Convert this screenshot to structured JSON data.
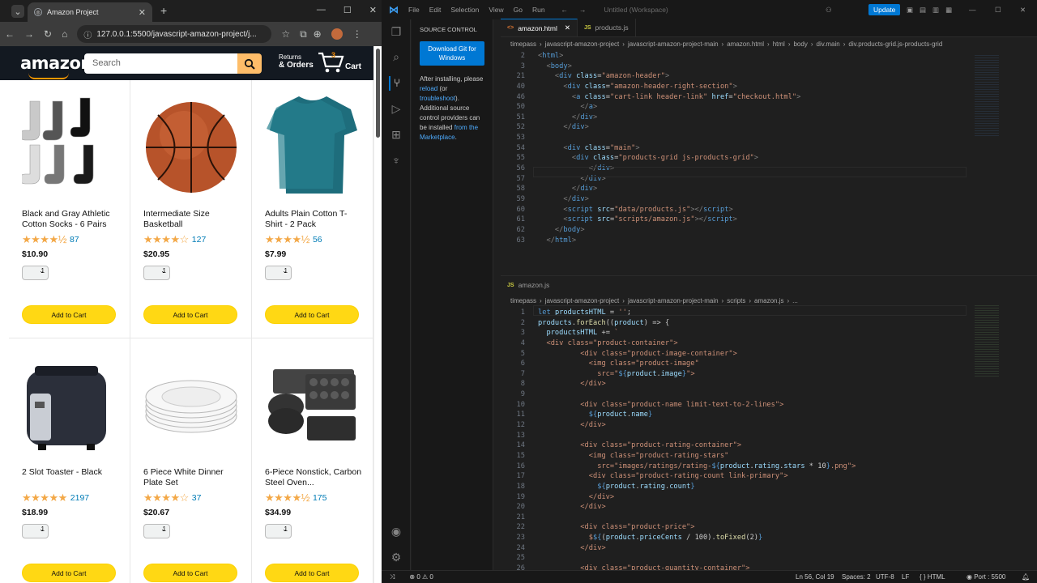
{
  "browser": {
    "tab_title": "Amazon Project",
    "url": "127.0.0.1:5500/javascript-amazon-project/j..."
  },
  "amazon": {
    "logo": "amazon",
    "search_placeholder": "Search",
    "returns_line1": "Returns",
    "returns_line2": "& Orders",
    "cart_count": "3",
    "cart_label": "Cart",
    "products": [
      {
        "name": "Black and Gray Athletic Cotton Socks - 6 Pairs",
        "stars": "★★★★½",
        "count": "87",
        "price": "$10.90",
        "qty": "1",
        "add": "Add to Cart",
        "icon": "socks"
      },
      {
        "name": "Intermediate Size Basketball",
        "stars": "★★★★☆",
        "count": "127",
        "price": "$20.95",
        "qty": "1",
        "add": "Add to Cart",
        "icon": "basketball"
      },
      {
        "name": "Adults Plain Cotton T-Shirt - 2 Pack",
        "stars": "★★★★½",
        "count": "56",
        "price": "$7.99",
        "qty": "1",
        "add": "Add to Cart",
        "icon": "tshirt"
      },
      {
        "name": "2 Slot Toaster - Black",
        "stars": "★★★★★",
        "count": "2197",
        "price": "$18.99",
        "qty": "1",
        "add": "Add to Cart",
        "icon": "toaster"
      },
      {
        "name": "6 Piece White Dinner Plate Set",
        "stars": "★★★★☆",
        "count": "37",
        "price": "$20.67",
        "qty": "1",
        "add": "Add to Cart",
        "icon": "plates"
      },
      {
        "name": "6-Piece Nonstick, Carbon Steel Oven...",
        "stars": "★★★★½",
        "count": "175",
        "price": "$34.99",
        "qty": "1",
        "add": "Add to Cart",
        "icon": "bakeware"
      }
    ]
  },
  "vscode": {
    "menu": [
      "File",
      "Edit",
      "Selection",
      "View",
      "Go",
      "Run"
    ],
    "workspace": "Untitled (Workspace)",
    "update_label": "Update",
    "sidebar_title": "SOURCE CONTROL",
    "download_git": "Download Git for Windows",
    "sidebar_text1": "After installing, please",
    "sidebar_link_reload": "reload",
    "sidebar_text2": "(or",
    "sidebar_link_troubleshoot": "troubleshoot",
    "sidebar_text3": "). Additional source control providers can be installed",
    "sidebar_link_marketplace": "from the Marketplace",
    "editor1": {
      "tabs": [
        {
          "label": "amazon.html",
          "active": true
        },
        {
          "label": "products.js",
          "active": false
        }
      ],
      "breadcrumb": [
        "timepass",
        "javascript-amazon-project",
        "javascript-amazon-project-main",
        "amazon.html",
        "html",
        "body",
        "div.main",
        "div.products-grid.js-products-grid"
      ],
      "lines": [
        {
          "n": "2",
          "html": "<span class='punc'>&lt;</span><span class='tag'>html</span><span class='punc'>&gt;</span>"
        },
        {
          "n": "3",
          "html": "  <span class='punc'>&lt;</span><span class='tag'>body</span><span class='punc'>&gt;</span>"
        },
        {
          "n": "21",
          "html": "    <span class='punc'>&lt;</span><span class='tag'>div</span> <span class='attr'>class</span>=<span class='str'>\"amazon-header\"</span><span class='punc'>&gt;</span>"
        },
        {
          "n": "40",
          "html": "      <span class='punc'>&lt;</span><span class='tag'>div</span> <span class='attr'>class</span>=<span class='str'>\"amazon-header-right-section\"</span><span class='punc'>&gt;</span>"
        },
        {
          "n": "46",
          "html": "        <span class='punc'>&lt;</span><span class='tag'>a</span> <span class='attr'>class</span>=<span class='str'>\"cart-link header-link\"</span> <span class='attr'>href</span>=<span class='str'>\"checkout.html\"</span><span class='punc'>&gt;</span>"
        },
        {
          "n": "50",
          "html": "          <span class='punc'>&lt;/</span><span class='tag'>a</span><span class='punc'>&gt;</span>"
        },
        {
          "n": "51",
          "html": "        <span class='punc'>&lt;/</span><span class='tag'>div</span><span class='punc'>&gt;</span>"
        },
        {
          "n": "52",
          "html": "      <span class='punc'>&lt;/</span><span class='tag'>div</span><span class='punc'>&gt;</span>"
        },
        {
          "n": "53",
          "html": ""
        },
        {
          "n": "54",
          "html": "      <span class='punc'>&lt;</span><span class='tag'>div</span> <span class='attr'>class</span>=<span class='str'>\"main\"</span><span class='punc'>&gt;</span>"
        },
        {
          "n": "55",
          "html": "        <span class='punc'>&lt;</span><span class='tag'>div</span> <span class='attr'>class</span>=<span class='str'>\"products-grid js-products-grid\"</span><span class='punc'>&gt;</span>"
        },
        {
          "n": "56",
          "html": "            <span class='punc'>&lt;/</span><span class='tag'>div</span><span class='punc'>&gt;</span>"
        },
        {
          "n": "57",
          "html": "          <span class='punc'>&lt;/</span><span class='tag'>div</span><span class='punc'>&gt;</span>"
        },
        {
          "n": "58",
          "html": "        <span class='punc'>&lt;/</span><span class='tag'>div</span><span class='punc'>&gt;</span>"
        },
        {
          "n": "59",
          "html": "      <span class='punc'>&lt;/</span><span class='tag'>div</span><span class='punc'>&gt;</span>"
        },
        {
          "n": "60",
          "html": "      <span class='punc'>&lt;</span><span class='tag'>script</span> <span class='attr'>src</span>=<span class='str'>\"data/products.js\"</span><span class='punc'>&gt;&lt;/</span><span class='tag'>script</span><span class='punc'>&gt;</span>"
        },
        {
          "n": "61",
          "html": "      <span class='punc'>&lt;</span><span class='tag'>script</span> <span class='attr'>src</span>=<span class='str'>\"scripts/amazon.js\"</span><span class='punc'>&gt;&lt;/</span><span class='tag'>script</span><span class='punc'>&gt;</span>"
        },
        {
          "n": "62",
          "html": "    <span class='punc'>&lt;/</span><span class='tag'>body</span><span class='punc'>&gt;</span>"
        },
        {
          "n": "63",
          "html": "  <span class='punc'>&lt;/</span><span class='tag'>html</span><span class='punc'>&gt;</span>"
        }
      ]
    },
    "editor2": {
      "tab": "amazon.js",
      "breadcrumb": [
        "timepass",
        "javascript-amazon-project",
        "javascript-amazon-project-main",
        "scripts",
        "amazon.js",
        "..."
      ],
      "lines": [
        {
          "n": "1",
          "html": "<span class='kw'>let</span> <span class='var'>productsHTML</span> = <span class='str'>''</span>;"
        },
        {
          "n": "2",
          "html": "<span class='var'>products</span>.<span class='fn'>forEach</span>((<span class='var'>product</span>) =&gt; {"
        },
        {
          "n": "3",
          "html": "  <span class='var'>productsHTML</span> += <span class='str'>`</span>"
        },
        {
          "n": "4",
          "html": "<span class='str'>  &lt;div class=\"product-container\"&gt;</span>"
        },
        {
          "n": "5",
          "html": "<span class='str'>          &lt;div class=\"product-image-container\"&gt;</span>"
        },
        {
          "n": "6",
          "html": "<span class='str'>            &lt;img class=\"product-image\"</span>"
        },
        {
          "n": "7",
          "html": "<span class='str'>              src=\"</span><span class='kw'>${</span><span class='var'>product</span>.<span class='var'>image</span><span class='kw'>}</span><span class='str'>\"&gt;</span>"
        },
        {
          "n": "8",
          "html": "<span class='str'>          &lt;/div&gt;</span>"
        },
        {
          "n": "9",
          "html": ""
        },
        {
          "n": "10",
          "html": "<span class='str'>          &lt;div class=\"product-name limit-text-to-2-lines\"&gt;</span>"
        },
        {
          "n": "11",
          "html": "            <span class='kw'>${</span><span class='var'>product</span>.<span class='var'>name</span><span class='kw'>}</span>"
        },
        {
          "n": "12",
          "html": "<span class='str'>          &lt;/div&gt;</span>"
        },
        {
          "n": "13",
          "html": ""
        },
        {
          "n": "14",
          "html": "<span class='str'>          &lt;div class=\"product-rating-container\"&gt;</span>"
        },
        {
          "n": "15",
          "html": "<span class='str'>            &lt;img class=\"product-rating-stars\"</span>"
        },
        {
          "n": "16",
          "html": "<span class='str'>              src=\"images/ratings/rating-</span><span class='kw'>${</span><span class='var'>product</span>.<span class='var'>rating</span>.<span class='var'>stars</span> * 10<span class='kw'>}</span><span class='str'>.png\"&gt;</span>"
        },
        {
          "n": "17",
          "html": "<span class='str'>            &lt;div class=\"product-rating-count link-primary\"&gt;</span>"
        },
        {
          "n": "18",
          "html": "              <span class='kw'>${</span><span class='var'>product</span>.<span class='var'>rating</span>.<span class='var'>count</span><span class='kw'>}</span>"
        },
        {
          "n": "19",
          "html": "<span class='str'>            &lt;/div&gt;</span>"
        },
        {
          "n": "20",
          "html": "<span class='str'>          &lt;/div&gt;</span>"
        },
        {
          "n": "21",
          "html": ""
        },
        {
          "n": "22",
          "html": "<span class='str'>          &lt;div class=\"product-price\"&gt;</span>"
        },
        {
          "n": "23",
          "html": "            <span class='str'>$</span><span class='kw'>${</span>(<span class='var'>product</span>.<span class='var'>priceCents</span> / 100).<span class='fn'>toFixed</span>(2)<span class='kw'>}</span>"
        },
        {
          "n": "24",
          "html": "<span class='str'>          &lt;/div&gt;</span>"
        },
        {
          "n": "25",
          "html": ""
        },
        {
          "n": "26",
          "html": "<span class='str'>          &lt;div class=\"product-quantity-container\"&gt;</span>"
        }
      ]
    },
    "status": {
      "errors": "0",
      "warnings": "0",
      "position": "Ln 56, Col 19",
      "spaces": "Spaces: 2",
      "encoding": "UTF-8",
      "eol": "LF",
      "language": "HTML",
      "port": "Port : 5500"
    }
  }
}
